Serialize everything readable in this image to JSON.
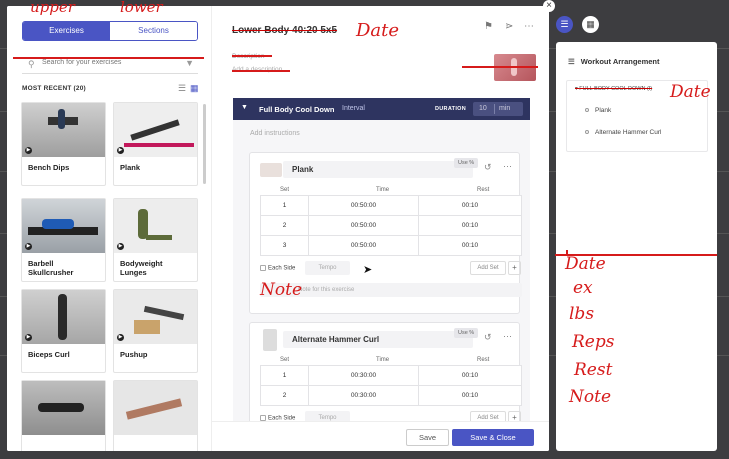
{
  "library": {
    "tabs": [
      "Exercises",
      "Sections"
    ],
    "search_placeholder": "Search for your exercises",
    "section_label": "MOST RECENT (20)",
    "cards": [
      {
        "name": "Bench Dips"
      },
      {
        "name": "Plank"
      },
      {
        "name": "Barbell Skullcrusher"
      },
      {
        "name": "Bodyweight Lunges"
      },
      {
        "name": "Biceps Curl"
      },
      {
        "name": "Pushup"
      },
      {
        "name": ""
      },
      {
        "name": ""
      }
    ]
  },
  "editor": {
    "title": "Lower Body 40:20 5x5",
    "description_label": "Description",
    "description_placeholder": "Add a description",
    "block": {
      "name": "Full Body Cool Down",
      "type": "Interval",
      "duration_label": "DURATION",
      "duration_value": "10",
      "duration_unit": "min",
      "instructions_placeholder": "Add instructions"
    },
    "columns": [
      "Set",
      "Time",
      "Rest"
    ],
    "exercises": [
      {
        "name": "Plank",
        "use_label": "Use %",
        "rows": [
          [
            "1",
            "00:50:00",
            "00:10"
          ],
          [
            "2",
            "00:50:00",
            "00:10"
          ],
          [
            "3",
            "00:50:00",
            "00:10"
          ]
        ],
        "each_side": "Each Side",
        "tempo": "Tempo",
        "add_set": "Add Set",
        "note_placeholder": "Note for this exercise"
      },
      {
        "name": "Alternate Hammer Curl",
        "use_label": "Use %",
        "rows": [
          [
            "1",
            "00:30:00",
            "00:10"
          ],
          [
            "2",
            "00:30:00",
            "00:10"
          ]
        ],
        "each_side": "Each Side",
        "tempo": "Tempo",
        "add_set": "Add Set"
      }
    ],
    "footer": {
      "save": "Save",
      "save_close": "Save & Close"
    }
  },
  "arrangement": {
    "title": "Workout Arrangement",
    "group": "FULL BODY COOL DOWN (I)",
    "items": [
      "Plank",
      "Alternate Hammer Curl"
    ]
  },
  "annotations": {
    "upper": "upper",
    "lower": "lower",
    "date_title": "Date",
    "date_tree": "Date",
    "note": "Note",
    "list": [
      "Date",
      "ex",
      "lbs",
      "Reps",
      "Rest",
      "Note"
    ]
  },
  "colors": {
    "accent": "#4a55c4",
    "block_header": "#2e3460",
    "ink": "#d61b1b"
  },
  "icons": [
    "search-icon",
    "filter-icon",
    "list-view-icon",
    "grid-view-icon",
    "tag-icon",
    "share-icon",
    "more-icon",
    "chevron-down-icon",
    "history-icon",
    "plus-icon",
    "list-icon",
    "calendar-icon",
    "close-icon",
    "play-icon",
    "cursor-icon"
  ]
}
